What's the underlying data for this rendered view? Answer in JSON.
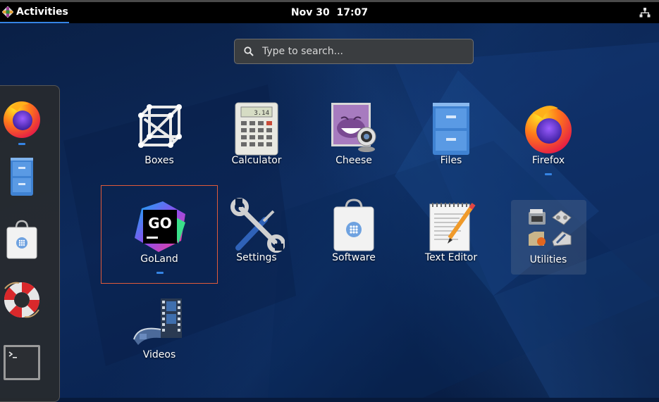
{
  "topbar": {
    "activities_label": "Activities",
    "clock_date": "Nov 30",
    "clock_time": "17:07",
    "accent": "#3584e4"
  },
  "search": {
    "placeholder": "Type to search..."
  },
  "dock": {
    "items": [
      {
        "name": "Firefox",
        "icon": "firefox-icon",
        "running": true
      },
      {
        "name": "Files",
        "icon": "files-icon",
        "running": false
      },
      {
        "name": "Software",
        "icon": "software-icon",
        "running": false
      },
      {
        "name": "Help",
        "icon": "help-lifebuoy-icon",
        "running": false
      },
      {
        "name": "Terminal",
        "icon": "terminal-icon",
        "running": false
      }
    ]
  },
  "apps": [
    {
      "label": "Boxes",
      "icon": "boxes-icon",
      "running": false,
      "selected": false
    },
    {
      "label": "Calculator",
      "icon": "calculator-icon",
      "running": false,
      "selected": false,
      "display": "3.14"
    },
    {
      "label": "Cheese",
      "icon": "cheese-icon",
      "running": false,
      "selected": false
    },
    {
      "label": "Files",
      "icon": "files-icon",
      "running": false,
      "selected": false
    },
    {
      "label": "Firefox",
      "icon": "firefox-icon",
      "running": true,
      "selected": false
    },
    {
      "label": "GoLand",
      "icon": "goland-icon",
      "running": true,
      "selected": true,
      "badge": "GO"
    },
    {
      "label": "Settings",
      "icon": "settings-icon",
      "running": false,
      "selected": false
    },
    {
      "label": "Software",
      "icon": "software-icon",
      "running": false,
      "selected": false
    },
    {
      "label": "Text Editor",
      "icon": "text-editor-icon",
      "running": false,
      "selected": false
    },
    {
      "label": "Utilities",
      "icon": "utilities-folder-icon",
      "running": false,
      "selected": false
    },
    {
      "label": "Videos",
      "icon": "videos-icon",
      "running": false,
      "selected": false
    }
  ]
}
